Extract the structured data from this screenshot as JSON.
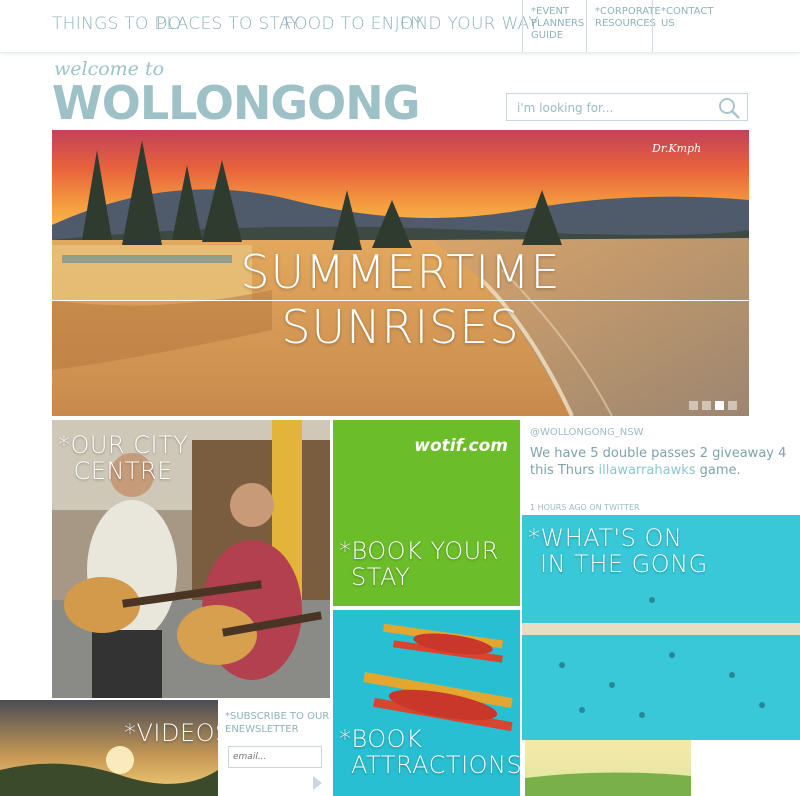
{
  "nav": {
    "items": [
      "THINGS TO DO",
      "PLACES TO STAY",
      "FOOD TO ENJOY",
      "FIND YOUR WAY"
    ],
    "sub": [
      {
        "label_lines": [
          "*EVENT",
          "PLANNERS",
          "GUIDE"
        ]
      },
      {
        "label_lines": [
          "*CORPORATE",
          "RESOURCES"
        ]
      },
      {
        "label_lines": [
          "*CONTACT",
          "US"
        ]
      }
    ]
  },
  "brand": {
    "welcome": "welcome to",
    "name": "WOLLONGONG"
  },
  "search": {
    "placeholder": "i'm looking for..."
  },
  "hero": {
    "line1": "SUMMERTIME",
    "line2": "SUNRISES",
    "signature": "Dr.Kmph",
    "slides": 4,
    "active_slide": 3
  },
  "tiles": {
    "city": {
      "title_lines": [
        "*OUR CITY",
        "CENTRE"
      ]
    },
    "stay": {
      "title_lines": [
        "*BOOK YOUR",
        "STAY"
      ],
      "logo": "wotif.com"
    },
    "attractions": {
      "title_lines": [
        "*BOOK",
        "ATTRACTIONS"
      ]
    },
    "whatson": {
      "title_lines": [
        "*WHAT'S ON",
        "IN THE GONG"
      ]
    },
    "videos": {
      "title": "*VIDEOS"
    }
  },
  "tweet": {
    "handle": "@WOLLONGONG_NSW",
    "text_before": "We have 5 double passes 2 giveaway 4 this Thurs ",
    "link": "illawarrahawks",
    "text_after": " game.",
    "meta": "1 HOURS AGO ON TWITTER"
  },
  "newsletter": {
    "label_lines": [
      "*SUBSCRIBE TO OUR",
      "ENEWSLETTER"
    ],
    "placeholder": "email..."
  },
  "colors": {
    "accent": "#8fb3bb",
    "wotif_green": "#6cbd2a",
    "sea_blue": "#2ec3d4",
    "aqua": "#29bfd2"
  }
}
